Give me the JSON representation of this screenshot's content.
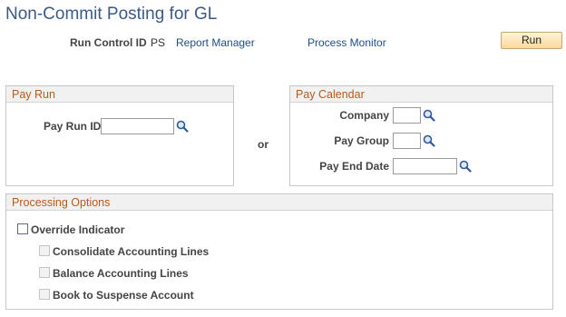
{
  "page": {
    "title": "Non-Commit Posting for GL"
  },
  "run_bar": {
    "run_control_label": "Run Control ID",
    "run_control_value": "PS",
    "report_manager": "Report Manager",
    "process_monitor": "Process Monitor",
    "run_button": "Run"
  },
  "pay_run": {
    "header": "Pay Run",
    "pay_run_id_label": "Pay Run ID",
    "pay_run_id_value": ""
  },
  "or_label": "or",
  "pay_calendar": {
    "header": "Pay Calendar",
    "company_label": "Company",
    "company_value": "",
    "pay_group_label": "Pay Group",
    "pay_group_value": "",
    "pay_end_date_label": "Pay End Date",
    "pay_end_date_value": ""
  },
  "processing": {
    "header": "Processing Options",
    "override_label": "Override Indicator",
    "consolidate_label": "Consolidate Accounting Lines",
    "balance_label": "Balance Accounting Lines",
    "suspense_label": "Book to Suspense Account"
  },
  "colors": {
    "title": "#3c5a85",
    "section_header_text": "#b65a1c",
    "link": "#1d4e89",
    "run_button_bg": "#fbd898"
  }
}
